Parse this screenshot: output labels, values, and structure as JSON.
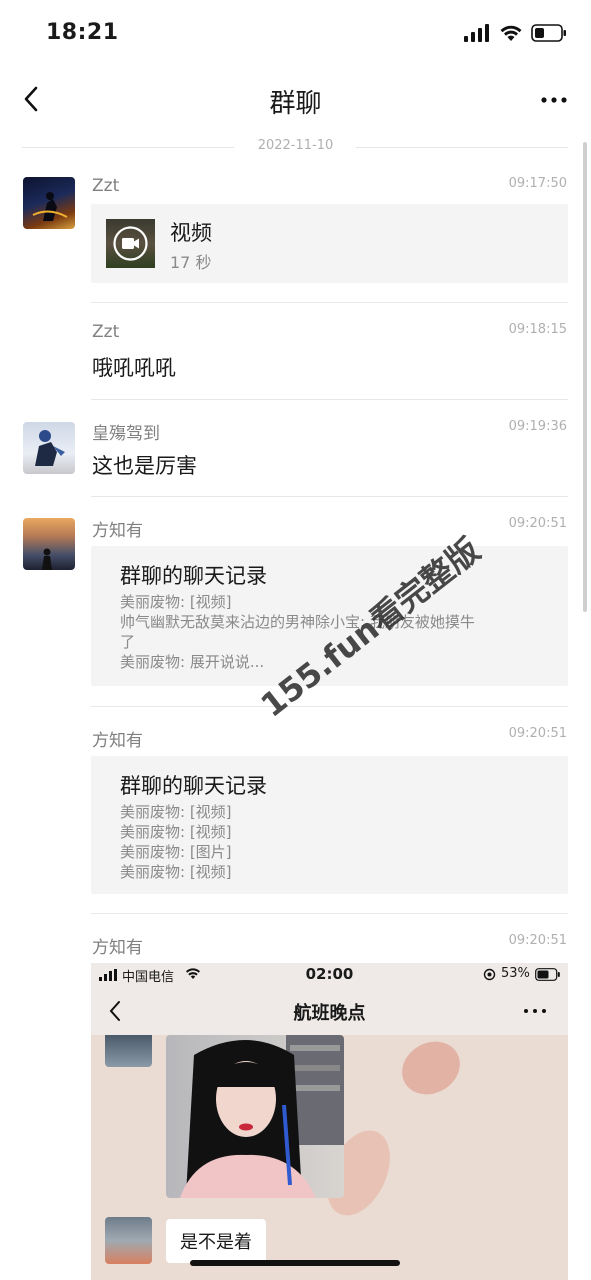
{
  "status_bar": {
    "time": "18:21"
  },
  "nav": {
    "title": "群聊"
  },
  "date_divider": "2022-11-10",
  "messages": [
    {
      "sender": "Zzt",
      "time": "09:17:50",
      "video_label": "视频",
      "video_duration": "17 秒"
    },
    {
      "sender": "Zzt",
      "time": "09:18:15",
      "text": "哦吼吼吼"
    },
    {
      "sender": "皇殤驾到",
      "time": "09:19:36",
      "text": "这也是厉害"
    },
    {
      "sender": "方知有",
      "time": "09:20:51",
      "card_title": "群聊的聊天记录",
      "card_lines": [
        "美丽废物: [视频]",
        "帅气幽默无敌莫来沾边的男神除小宝: 我朋友被她摸牛",
        "了",
        "美丽废物: 展开说说..."
      ]
    },
    {
      "sender": "方知有",
      "time": "09:20:51",
      "card_title": "群聊的聊天记录",
      "card_lines": [
        "美丽废物: [视频]",
        "美丽废物: [视频]",
        "美丽废物: [图片]",
        "美丽废物: [视频]"
      ]
    },
    {
      "sender": "方知有",
      "time": "09:20:51"
    }
  ],
  "nested_screenshot": {
    "carrier": "中国电信",
    "time": "02:00",
    "battery": "53%",
    "title": "航班晚点",
    "bubble_text": "是不是着"
  },
  "watermark": "155.fun看完整版"
}
